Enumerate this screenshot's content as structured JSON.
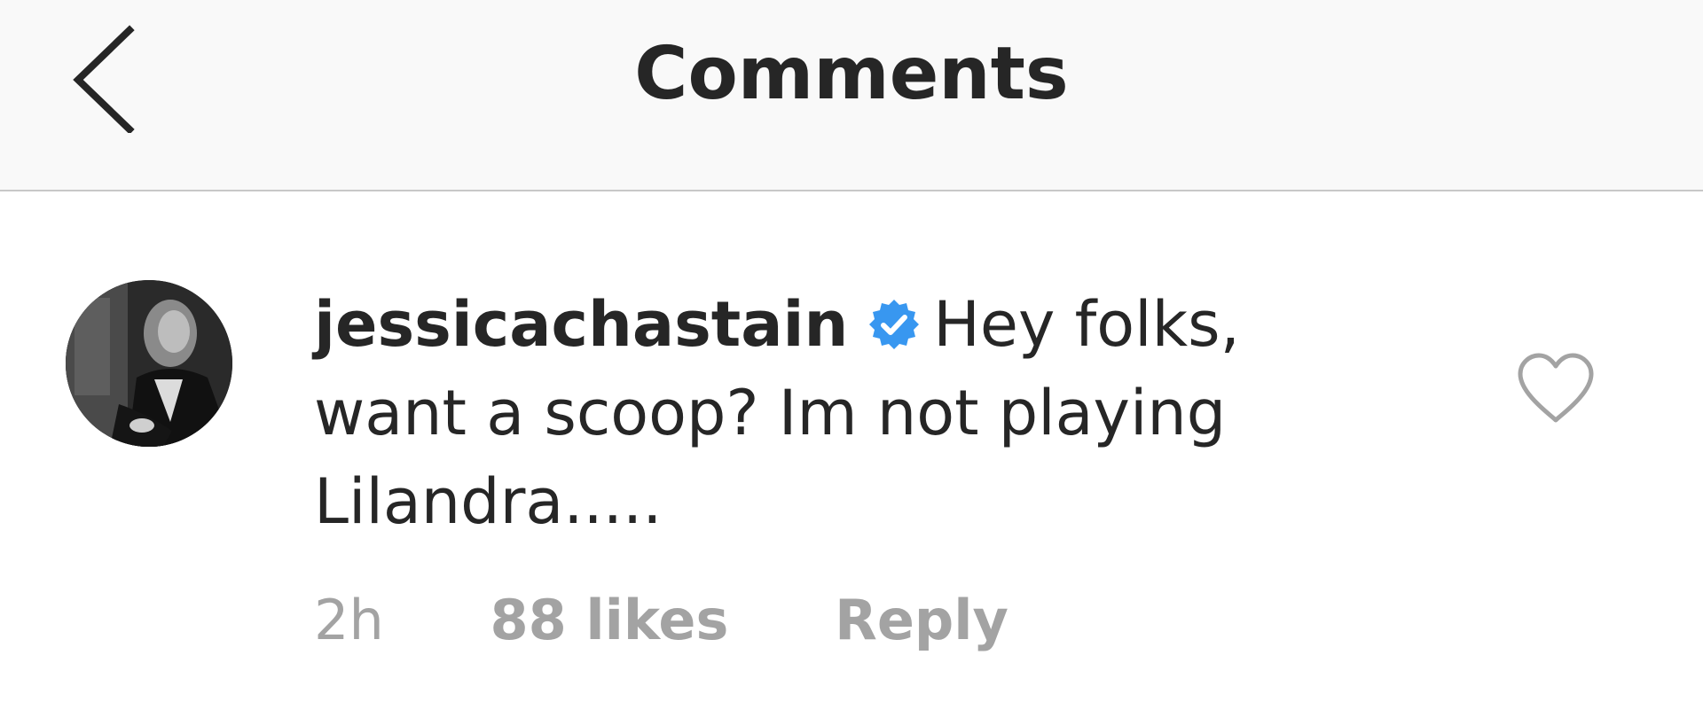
{
  "header": {
    "back_icon": "chevron-left-icon",
    "title": "Comments"
  },
  "comment": {
    "avatar_icon": "profile-photo",
    "username": "jessicachastain",
    "verified_icon": "verified-badge-icon",
    "text": "Hey folks, want a scoop? Im not playing Lilandra.....",
    "time": "2h",
    "likes": "88 likes",
    "reply_label": "Reply",
    "like_icon": "heart-outline-icon"
  },
  "colors": {
    "header_bg": "#f9f9f9",
    "text": "#262626",
    "meta": "#a3a3a3",
    "verified": "#3897f0",
    "divider": "#c8c8c8"
  }
}
